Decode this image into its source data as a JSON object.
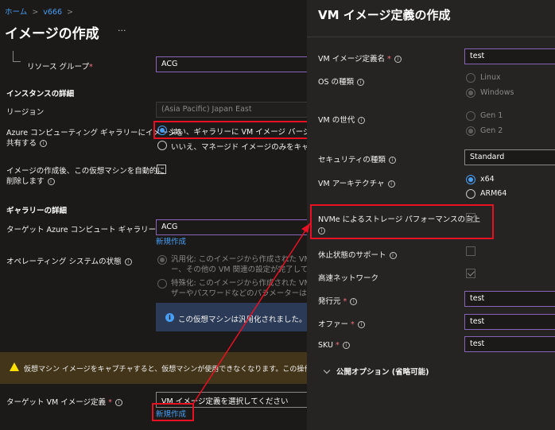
{
  "left": {
    "breadcrumb": {
      "home": "ホーム",
      "sep": ">",
      "resource": "v666",
      "sep2": ">"
    },
    "title": "イメージの作成",
    "more": "···",
    "resource_group": {
      "label": "リソース グループ",
      "value": "ACG"
    },
    "instance_section": "インスタンスの詳細",
    "region": {
      "label": "リージョン",
      "value": "(Asia Pacific) Japan East"
    },
    "share": {
      "label_line1": "Azure コンピューティング ギャラリーにイメージを",
      "label_line2": "共有する",
      "option_yes": "はい、ギャラリーに VM イメージ バージョンとして",
      "option_no": "いいえ、マネージド イメージのみをキャプチャしま"
    },
    "autodelete": {
      "label_line1": "イメージの作成後、この仮想マシンを自動的に",
      "label_line2": "削除します"
    },
    "gallery_section": "ギャラリーの詳細",
    "target_gallery": {
      "label": "ターゲット Azure コンピュート ギャラリー",
      "value": "ACG",
      "create_link": "新規作成"
    },
    "os_state": {
      "label": "オペレーティング システムの状態",
      "generalized_line1": "汎用化: このイメージから作成された VM では",
      "generalized_line2": "ー、その他の VM 関連の設定が完了している",
      "specialized_line1": "特殊化: このイメージから作成された VM は完",
      "specialized_line2": "ザーやパスワードなどのパラメーターは必要あり",
      "info_text": "この仮想マシンは汎用化されました。"
    },
    "warning": "仮想マシン イメージをキャプチャすると、仮想マシンが使用できなくなります。この操作を元に戻すことは",
    "target_def": {
      "label": "ターゲット VM イメージ定義",
      "placeholder": "VM イメージ定義を選択してください",
      "create_link": "新規作成"
    }
  },
  "right": {
    "title": "VM イメージ定義の作成",
    "name": {
      "label": "VM イメージ定義名",
      "value": "test"
    },
    "os_type": {
      "label": "OS の種類",
      "linux": "Linux",
      "windows": "Windows"
    },
    "generation": {
      "label": "VM の世代",
      "gen1": "Gen 1",
      "gen2": "Gen 2"
    },
    "security": {
      "label": "セキュリティの種類",
      "value": "Standard"
    },
    "arch": {
      "label": "VM アーキテクチャ",
      "x64": "x64",
      "arm64": "ARM64"
    },
    "nvme": {
      "label": "NVMe によるストレージ パフォーマンスの向上"
    },
    "hibernate": {
      "label": "休止状態のサポート"
    },
    "accel_net": {
      "label": "高速ネットワーク"
    },
    "publisher": {
      "label": "発行元",
      "value": "test"
    },
    "offer": {
      "label": "オファー",
      "value": "test"
    },
    "sku": {
      "label": "SKU",
      "value": "test"
    },
    "publish_options": "公開オプション (省略可能)"
  },
  "colors": {
    "accent": "#479ef5",
    "highlight": "#e81123",
    "purple_border": "#8764b8"
  }
}
